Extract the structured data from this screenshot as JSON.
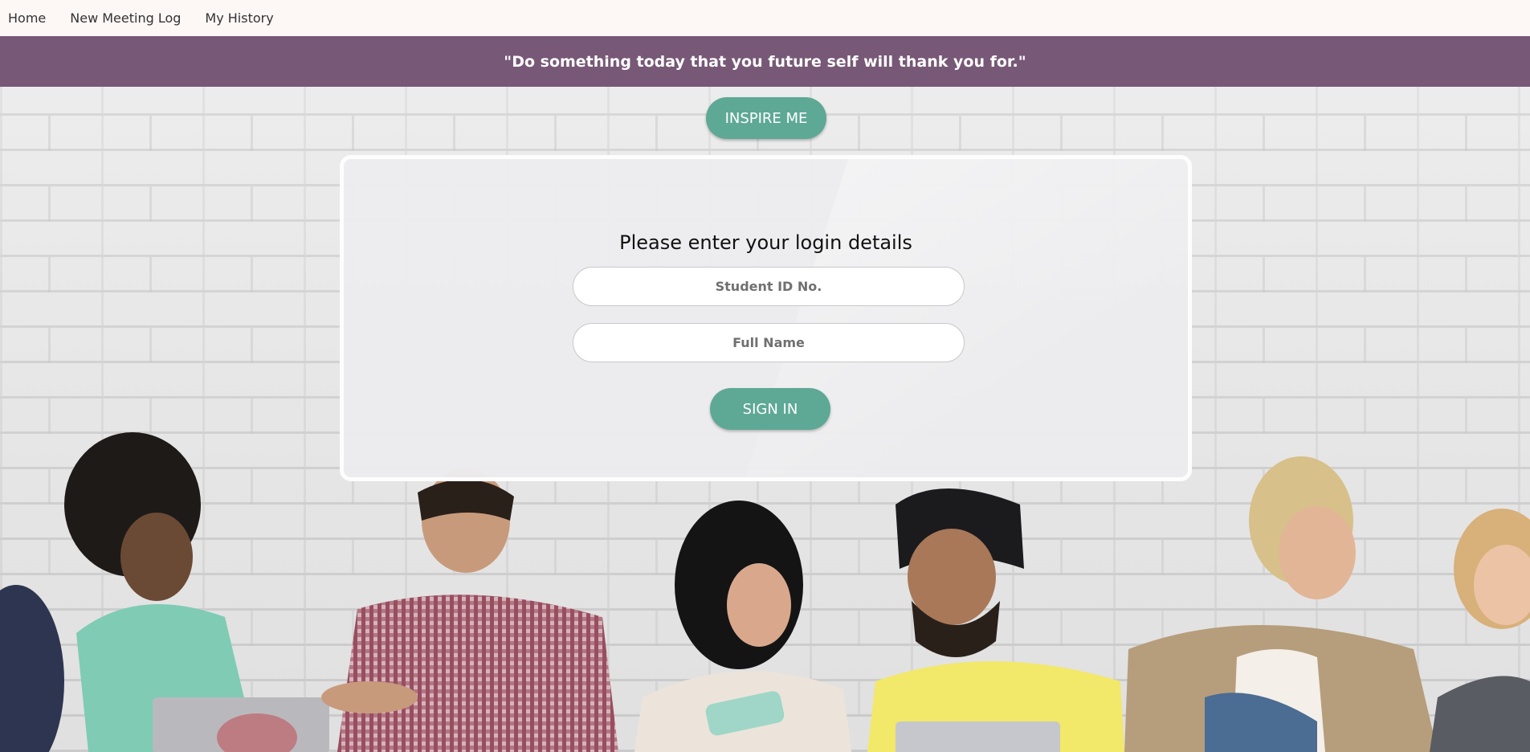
{
  "nav": {
    "items": [
      {
        "label": "Home"
      },
      {
        "label": "New Meeting Log"
      },
      {
        "label": "My History"
      }
    ]
  },
  "quote": {
    "text": "\"Do something today that you future self will thank you for.\""
  },
  "inspire_button": {
    "label": "INSPIRE ME"
  },
  "login": {
    "title": "Please enter your login details",
    "student_id": {
      "placeholder": "Student ID No.",
      "value": ""
    },
    "full_name": {
      "placeholder": "Full Name",
      "value": ""
    },
    "submit_label": "SIGN IN"
  },
  "colors": {
    "nav_bg": "#fdf7f6",
    "quote_bar": "#775876",
    "accent_button": "#5ea896"
  }
}
